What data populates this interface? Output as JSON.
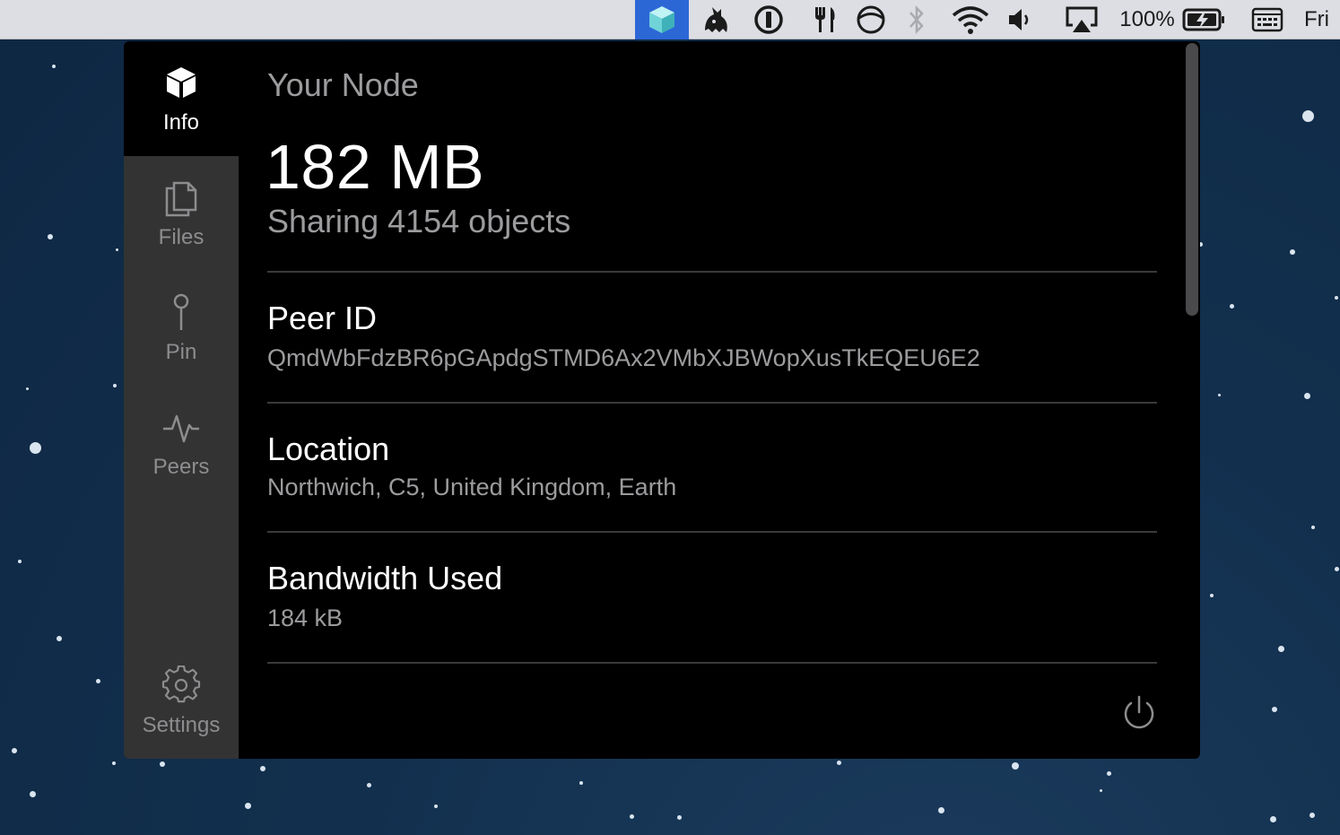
{
  "menubar": {
    "icons": [
      "ipfs-cube-icon",
      "bird-icon",
      "password-icon",
      "fork-knife-icon",
      "half-circle-icon",
      "bluetooth-icon",
      "wifi-icon",
      "volume-icon",
      "airplay-icon",
      "battery-icon",
      "keyboard-icon"
    ],
    "battery_percent": "100%",
    "clock_day": "Fri"
  },
  "sidebar": {
    "items": [
      {
        "label": "Info",
        "icon": "cube-icon",
        "active": true
      },
      {
        "label": "Files",
        "icon": "files-icon",
        "active": false
      },
      {
        "label": "Pin",
        "icon": "pin-icon",
        "active": false
      },
      {
        "label": "Peers",
        "icon": "pulse-icon",
        "active": false
      }
    ],
    "settings": {
      "label": "Settings",
      "icon": "gear-icon"
    }
  },
  "node": {
    "heading": "Your Node",
    "storage_size": "182 MB",
    "sharing_text": "Sharing 4154 objects",
    "fields": [
      {
        "title": "Peer ID",
        "value": "QmdWbFdzBR6pGApdgSTMD6Ax2VMbXJBWopXusTkEQEU6E2"
      },
      {
        "title": "Location",
        "value": "Northwich, C5, United Kingdom, Earth"
      },
      {
        "title": "Bandwidth Used",
        "value": "184 kB"
      }
    ]
  },
  "colors": {
    "sidebar_bg": "#333334",
    "content_bg": "#000000",
    "muted_text": "#9c9c9f",
    "menubar_active": "#2c67d6",
    "accent_cube": "#6fd3d8"
  }
}
